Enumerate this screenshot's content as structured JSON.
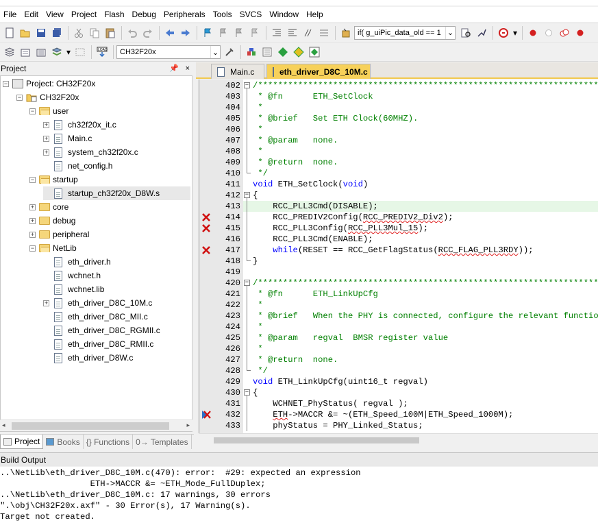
{
  "menu": [
    "File",
    "Edit",
    "View",
    "Project",
    "Flash",
    "Debug",
    "Peripherals",
    "Tools",
    "SVCS",
    "Window",
    "Help"
  ],
  "toolbar": {
    "find_combo": "if( g_uiPic_data_old == 1",
    "target_combo": "CH32F20x"
  },
  "project_pane": {
    "title": "Project",
    "pin": "ᵖ",
    "close": "×",
    "tree": [
      {
        "label": "Project: CH32F20x",
        "level": 0,
        "kind": "project",
        "expander": "−"
      },
      {
        "label": "CH32F20x",
        "level": 1,
        "kind": "target",
        "expander": "−"
      },
      {
        "label": "user",
        "level": 2,
        "kind": "folder-open",
        "expander": "−"
      },
      {
        "label": "ch32f20x_it.c",
        "level": 3,
        "kind": "file",
        "expander": "+"
      },
      {
        "label": "Main.c",
        "level": 3,
        "kind": "file",
        "expander": "+"
      },
      {
        "label": "system_ch32f20x.c",
        "level": 3,
        "kind": "file",
        "expander": "+"
      },
      {
        "label": "net_config.h",
        "level": 3,
        "kind": "file",
        "expander": ""
      },
      {
        "label": "startup",
        "level": 2,
        "kind": "folder-open",
        "expander": "−"
      },
      {
        "label": "startup_ch32f20x_D8W.s",
        "level": 3,
        "kind": "file",
        "expander": "",
        "selected": true
      },
      {
        "label": "core",
        "level": 2,
        "kind": "folder",
        "expander": "+"
      },
      {
        "label": "debug",
        "level": 2,
        "kind": "folder",
        "expander": "+"
      },
      {
        "label": "peripheral",
        "level": 2,
        "kind": "folder",
        "expander": "+"
      },
      {
        "label": "NetLib",
        "level": 2,
        "kind": "folder-open",
        "expander": "−"
      },
      {
        "label": "eth_driver.h",
        "level": 3,
        "kind": "file",
        "expander": ""
      },
      {
        "label": "wchnet.h",
        "level": 3,
        "kind": "file",
        "expander": ""
      },
      {
        "label": "wchnet.lib",
        "level": 3,
        "kind": "file",
        "expander": ""
      },
      {
        "label": "eth_driver_D8C_10M.c",
        "level": 3,
        "kind": "file",
        "expander": "+"
      },
      {
        "label": "eth_driver_D8C_MII.c",
        "level": 3,
        "kind": "file",
        "expander": ""
      },
      {
        "label": "eth_driver_D8C_RGMII.c",
        "level": 3,
        "kind": "file",
        "expander": ""
      },
      {
        "label": "eth_driver_D8C_RMII.c",
        "level": 3,
        "kind": "file",
        "expander": ""
      },
      {
        "label": "eth_driver_D8W.c",
        "level": 3,
        "kind": "file",
        "expander": ""
      }
    ],
    "bottom_tabs": [
      "Project",
      "Books",
      "{} Functions",
      "0→ Templates"
    ]
  },
  "editor": {
    "tabs": [
      {
        "label": "Main.c",
        "active": false
      },
      {
        "label": "eth_driver_D8C_10M.c",
        "active": true
      }
    ],
    "lines": [
      {
        "n": "402",
        "fold": "box-",
        "err": false,
        "hl": false,
        "html": "<span class='cmt'>/******************************************************************************</span>"
      },
      {
        "n": "403",
        "fold": "line",
        "err": false,
        "hl": false,
        "html": "<span class='cmt'> * @fn      ETH_SetClock</span>"
      },
      {
        "n": "404",
        "fold": "line",
        "err": false,
        "hl": false,
        "html": "<span class='cmt'> *</span>"
      },
      {
        "n": "405",
        "fold": "line",
        "err": false,
        "hl": false,
        "html": "<span class='cmt'> * @brief   Set ETH Clock(60MHZ).</span>"
      },
      {
        "n": "406",
        "fold": "line",
        "err": false,
        "hl": false,
        "html": "<span class='cmt'> *</span>"
      },
      {
        "n": "407",
        "fold": "line",
        "err": false,
        "hl": false,
        "html": "<span class='cmt'> * @param   none.</span>"
      },
      {
        "n": "408",
        "fold": "line",
        "err": false,
        "hl": false,
        "html": "<span class='cmt'> *</span>"
      },
      {
        "n": "409",
        "fold": "line",
        "err": false,
        "hl": false,
        "html": "<span class='cmt'> * @return  none.</span>"
      },
      {
        "n": "410",
        "fold": "corner",
        "err": false,
        "hl": false,
        "html": "<span class='cmt'> */</span>"
      },
      {
        "n": "411",
        "fold": "",
        "err": false,
        "hl": false,
        "html": "<span class='kw'>void</span> ETH_SetClock(<span class='kw'>void</span>)"
      },
      {
        "n": "412",
        "fold": "box-",
        "err": false,
        "hl": false,
        "html": "{"
      },
      {
        "n": "413",
        "fold": "line",
        "err": false,
        "hl": true,
        "html": "    RCC_PLL3Cmd(DISABLE);"
      },
      {
        "n": "414",
        "fold": "line",
        "err": true,
        "hl": false,
        "html": "    RCC_PREDIV2Config(<span class='sq'>RCC_PREDIV2_Div2</span>);"
      },
      {
        "n": "415",
        "fold": "line",
        "err": true,
        "hl": false,
        "html": "    RCC_PLL3Config(<span class='sq'>RCC_PLL3Mul_15</span>);"
      },
      {
        "n": "416",
        "fold": "line",
        "err": false,
        "hl": false,
        "html": "    RCC_PLL3Cmd(ENABLE);"
      },
      {
        "n": "417",
        "fold": "line",
        "err": true,
        "hl": false,
        "html": "    <span class='kw'>while</span>(RESET == RCC_GetFlagStatus(<span class='sq'>RCC_FLAG_PLL3RDY</span>));"
      },
      {
        "n": "418",
        "fold": "corner",
        "err": false,
        "hl": false,
        "html": "}"
      },
      {
        "n": "419",
        "fold": "",
        "err": false,
        "hl": false,
        "html": ""
      },
      {
        "n": "420",
        "fold": "box-",
        "err": false,
        "hl": false,
        "html": "<span class='cmt'>/******************************************************************************</span>"
      },
      {
        "n": "421",
        "fold": "line",
        "err": false,
        "hl": false,
        "html": "<span class='cmt'> * @fn      ETH_LinkUpCfg</span>"
      },
      {
        "n": "422",
        "fold": "line",
        "err": false,
        "hl": false,
        "html": "<span class='cmt'> *</span>"
      },
      {
        "n": "423",
        "fold": "line",
        "err": false,
        "hl": false,
        "html": "<span class='cmt'> * @brief   When the PHY is connected, configure the relevant functions.</span>"
      },
      {
        "n": "424",
        "fold": "line",
        "err": false,
        "hl": false,
        "html": "<span class='cmt'> *</span>"
      },
      {
        "n": "425",
        "fold": "line",
        "err": false,
        "hl": false,
        "html": "<span class='cmt'> * @param   regval  BMSR register value</span>"
      },
      {
        "n": "426",
        "fold": "line",
        "err": false,
        "hl": false,
        "html": "<span class='cmt'> *</span>"
      },
      {
        "n": "427",
        "fold": "line",
        "err": false,
        "hl": false,
        "html": "<span class='cmt'> * @return  none.</span>"
      },
      {
        "n": "428",
        "fold": "corner",
        "err": false,
        "hl": false,
        "html": "<span class='cmt'> */</span>"
      },
      {
        "n": "429",
        "fold": "",
        "err": false,
        "hl": false,
        "html": "<span class='kw'>void</span> ETH_LinkUpCfg(uint16_t regval)"
      },
      {
        "n": "430",
        "fold": "box-",
        "err": false,
        "hl": false,
        "html": "{"
      },
      {
        "n": "431",
        "fold": "line",
        "err": false,
        "hl": false,
        "html": "    WCHNET_PhyStatus( regval );"
      },
      {
        "n": "432",
        "fold": "line",
        "err": "arrow",
        "hl": false,
        "html": "    <span class='sq'>ETH</span>-&gt;MACCR &amp;= ~(ETH_Speed_100M|ETH_Speed_1000M);"
      },
      {
        "n": "433",
        "fold": "line",
        "err": false,
        "hl": false,
        "html": "    phyStatus = PHY_Linked_Status;"
      }
    ]
  },
  "build_output": {
    "title": "Build Output",
    "lines": [
      "..\\NetLib\\eth_driver_D8C_10M.c(470): error:  #29: expected an expression",
      "                  ETH->MACCR &= ~ETH_Mode_FullDuplex;",
      "..\\NetLib\\eth_driver_D8C_10M.c: 17 warnings, 30 errors",
      "\".\\obj\\CH32F20x.axf\" - 30 Error(s), 17 Warning(s).",
      "Target not created."
    ]
  },
  "colors": {
    "comment": "#008000",
    "keyword": "#0000ff",
    "active_tab": "#f7d15a",
    "error_mark": "#d01010"
  }
}
